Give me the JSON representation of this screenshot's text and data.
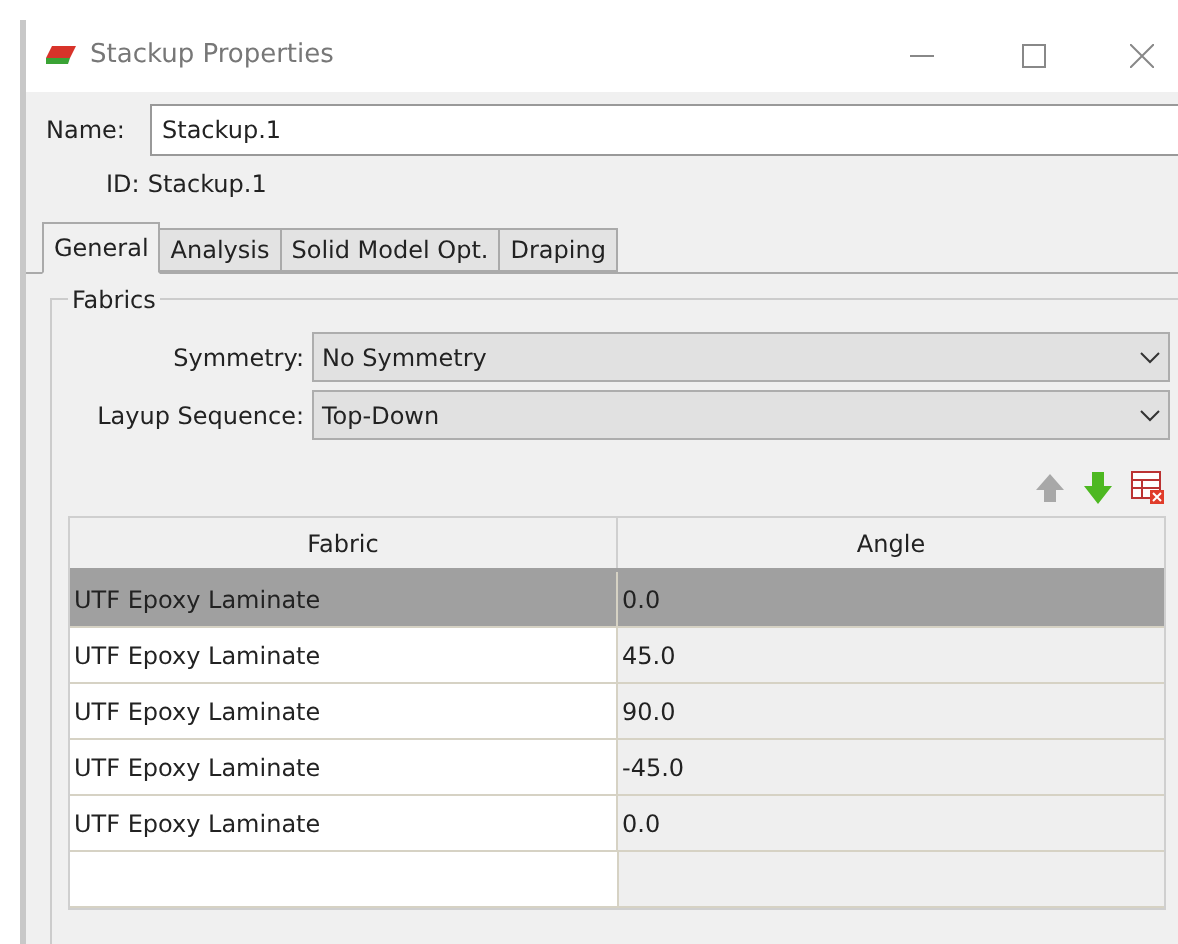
{
  "window": {
    "title": "Stackup Properties"
  },
  "name_field": {
    "label": "Name:",
    "value": "Stackup.1"
  },
  "id": {
    "label": "ID:",
    "value": "Stackup.1"
  },
  "tabs": [
    {
      "label": "General",
      "selected": true
    },
    {
      "label": "Analysis",
      "selected": false
    },
    {
      "label": "Solid Model Opt.",
      "selected": false
    },
    {
      "label": "Draping",
      "selected": false
    }
  ],
  "group": {
    "title": "Fabrics"
  },
  "combos": [
    {
      "label": "Symmetry:",
      "value": "No Symmetry"
    },
    {
      "label": "Layup Sequence:",
      "value": "Top-Down"
    }
  ],
  "toolbar": [
    {
      "kind": "up",
      "disabled": true
    },
    {
      "kind": "down",
      "disabled": false
    },
    {
      "kind": "delete",
      "disabled": false
    }
  ],
  "table": {
    "columns": [
      "Fabric",
      "Angle"
    ],
    "rows": [
      {
        "fabric": "UTF Epoxy Laminate",
        "angle": "0.0",
        "selected": true
      },
      {
        "fabric": "UTF Epoxy Laminate",
        "angle": "45.0",
        "selected": false
      },
      {
        "fabric": "UTF Epoxy Laminate",
        "angle": "90.0",
        "selected": false
      },
      {
        "fabric": "UTF Epoxy Laminate",
        "angle": "-45.0",
        "selected": false
      },
      {
        "fabric": "UTF Epoxy Laminate",
        "angle": "0.0",
        "selected": false
      }
    ]
  }
}
